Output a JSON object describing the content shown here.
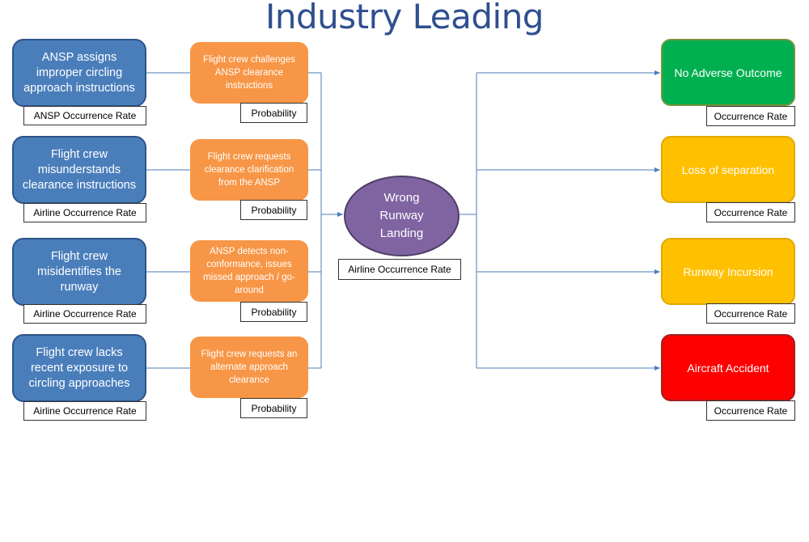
{
  "title": "Industry Leading",
  "causes": [
    {
      "text": "ANSP assigns improper circling approach instructions",
      "label": "ANSP Occurrence Rate"
    },
    {
      "text": "Flight crew misunderstands clearance instructions",
      "label": "Airline Occurrence Rate"
    },
    {
      "text": "Flight crew misidentifies the runway",
      "label": "Airline Occurrence Rate"
    },
    {
      "text": "Flight crew lacks recent exposure to circling approaches",
      "label": "Airline Occurrence Rate"
    }
  ],
  "barriers": [
    {
      "text": "Flight crew challenges ANSP clearance instructions",
      "label": "Probability"
    },
    {
      "text": "Flight crew requests clearance clarification from the ANSP",
      "label": "Probability"
    },
    {
      "text": "ANSP detects non-conformance, issues missed approach / go-around",
      "label": "Probability"
    },
    {
      "text": "Flight crew requests an alternate approach clearance",
      "label": "Probability"
    }
  ],
  "event": {
    "text": "Wrong Runway Landing",
    "label": "Airline Occurrence Rate"
  },
  "outcomes": [
    {
      "text": "No Adverse Outcome",
      "label": "Occurrence Rate",
      "color": "#00b050",
      "border": "#77933c"
    },
    {
      "text": "Loss of separation",
      "label": "Occurrence Rate",
      "color": "#ffc000",
      "border": "#e0a800"
    },
    {
      "text": "Runway Incursion",
      "label": "Occurrence Rate",
      "color": "#ffc000",
      "border": "#e0a800"
    },
    {
      "text": "Aircraft Accident",
      "label": "Occurrence Rate",
      "color": "#ff0000",
      "border": "#a02020"
    }
  ],
  "colors": {
    "line": "#4a7ebb",
    "cause": "#4a7ebb",
    "barrier": "#f79646",
    "event": "#8064a2"
  }
}
